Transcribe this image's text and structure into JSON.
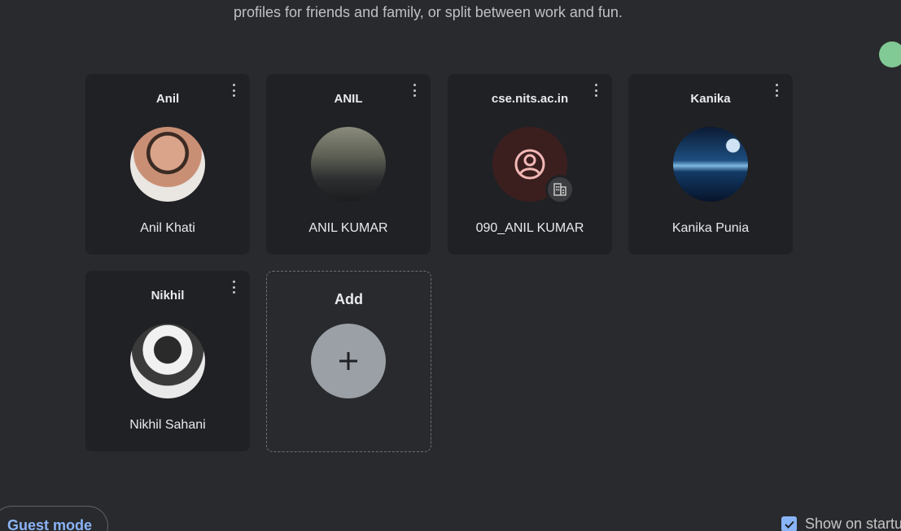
{
  "header": {
    "subtitle": "profiles for friends and family, or split between work and fun."
  },
  "profiles": [
    {
      "name": "Anil",
      "label": "Anil Khati",
      "avatar": "photo"
    },
    {
      "name": "ANIL",
      "label": "ANIL KUMAR",
      "avatar": "photo"
    },
    {
      "name": "cse.nits.ac.in",
      "label": "090_ANIL KUMAR",
      "avatar": "person-icon",
      "badge": "building-icon"
    },
    {
      "name": "Kanika",
      "label": "Kanika Punia",
      "avatar": "photo"
    },
    {
      "name": "Nikhil",
      "label": "Nikhil Sahani",
      "avatar": "photo"
    }
  ],
  "add_profile": {
    "label": "Add",
    "icon": "plus-icon"
  },
  "footer": {
    "guest_mode_label": "Guest mode",
    "show_on_startup_label": "Show on startu",
    "show_on_startup_checked": true
  },
  "colors": {
    "background": "#292a2d",
    "card": "#202124",
    "accent": "#8ab4f8",
    "green_dot": "#81c995"
  }
}
